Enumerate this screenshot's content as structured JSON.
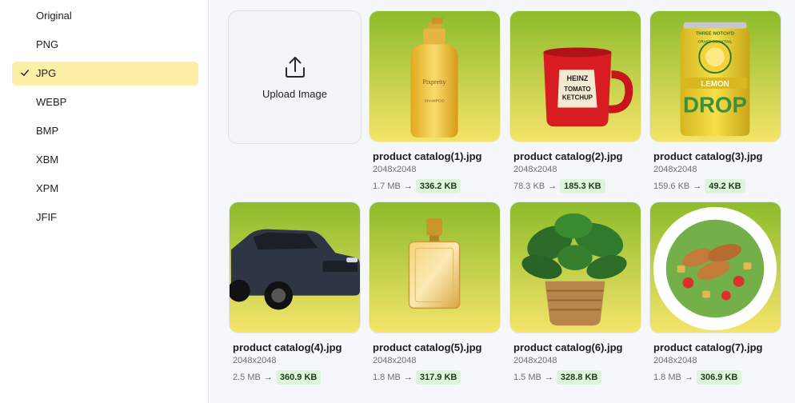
{
  "formats": [
    {
      "label": "Original",
      "selected": false
    },
    {
      "label": "PNG",
      "selected": false
    },
    {
      "label": "JPG",
      "selected": true
    },
    {
      "label": "WEBP",
      "selected": false
    },
    {
      "label": "BMP",
      "selected": false
    },
    {
      "label": "XBM",
      "selected": false
    },
    {
      "label": "XPM",
      "selected": false
    },
    {
      "label": "JFIF",
      "selected": false
    }
  ],
  "upload": {
    "label": "Upload Image",
    "icon": "upload-icon"
  },
  "arrow": "→",
  "images": [
    {
      "name": "product catalog(1).jpg",
      "dims": "2048x2048",
      "original": "1.7 MB",
      "converted": "336.2 KB",
      "subject": "shampoo-bottle"
    },
    {
      "name": "product catalog(2).jpg",
      "dims": "2048x2048",
      "original": "78.3 KB",
      "converted": "185.3 KB",
      "subject": "ketchup-mug"
    },
    {
      "name": "product catalog(3).jpg",
      "dims": "2048x2048",
      "original": "159.6 KB",
      "converted": "49.2 KB",
      "subject": "drink-can"
    },
    {
      "name": "product catalog(4).jpg",
      "dims": "2048x2048",
      "original": "2.5 MB",
      "converted": "360.9 KB",
      "subject": "suv-car"
    },
    {
      "name": "product catalog(5).jpg",
      "dims": "2048x2048",
      "original": "1.8 MB",
      "converted": "317.9 KB",
      "subject": "perfume-bottle"
    },
    {
      "name": "product catalog(6).jpg",
      "dims": "2048x2048",
      "original": "1.5 MB",
      "converted": "328.8 KB",
      "subject": "potted-plant"
    },
    {
      "name": "product catalog(7).jpg",
      "dims": "2048x2048",
      "original": "1.8 MB",
      "converted": "306.9 KB",
      "subject": "salad-plate"
    }
  ],
  "image_texts": {
    "shampoo": [
      "Pixpretty",
      "SHAMPOO"
    ],
    "ketchup": [
      "HEINZ",
      "TOMATO",
      "KETCHUP"
    ],
    "can": [
      "THREE NOTCH'D",
      "CRAFT COCKTAIL",
      "LEMON",
      "DROP"
    ]
  },
  "colors": {
    "accent_selected": "#fdf0a6",
    "badge_bg": "#dcf5dc",
    "thumb_gradient_top": "#8dbb2c",
    "thumb_gradient_bottom": "#f4e46a"
  }
}
